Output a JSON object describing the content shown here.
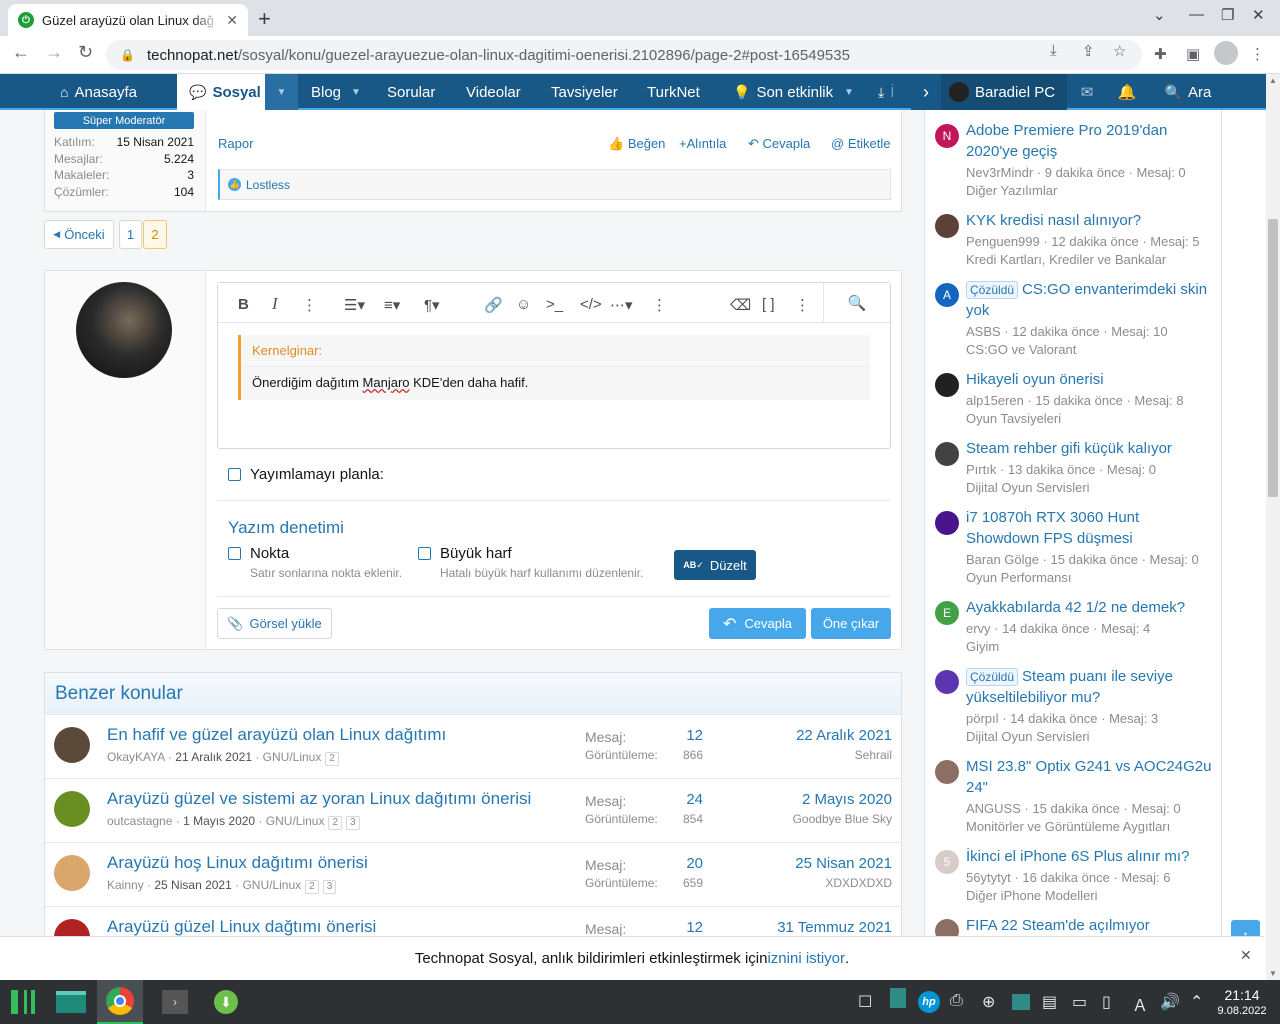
{
  "browser": {
    "tab_title": "Güzel arayüzü olan Linux dağ",
    "url_host": "technopat.net",
    "url_path": "/sosyal/konu/guezel-arayuezue-olan-linux-dagitimi-oenerisi.2102896/page-2#post-16549535",
    "icons": [
      "back-icon",
      "forward-icon",
      "reload-icon",
      "lock-icon",
      "install-icon",
      "share-icon",
      "star-icon",
      "extensions-icon",
      "sidepanel-icon",
      "profile-icon"
    ]
  },
  "nav": {
    "items": [
      "Anasayfa",
      "Sosyal",
      "Blog",
      "Sorular",
      "Videolar",
      "Tavsiyeler",
      "TurkNet",
      "Son etkinlik"
    ],
    "overflow": "İ",
    "account": "Baradiel PC",
    "search": "Ara",
    "colors": {
      "bar": "#185886",
      "accent": "#47a7eb"
    }
  },
  "post": {
    "role_badge": "Süper Moderatör",
    "stats": [
      {
        "k": "Katılım:",
        "v": "15 Nisan 2021"
      },
      {
        "k": "Mesajlar:",
        "v": "5.224"
      },
      {
        "k": "Makaleler:",
        "v": "3"
      },
      {
        "k": "Çözümler:",
        "v": "104"
      }
    ],
    "report": "Rapor",
    "actions": [
      "Beğen",
      "Alıntıla",
      "Cevapla",
      "Etiketle"
    ],
    "reaction_user": "Lostless"
  },
  "pagination": {
    "prev": "Önceki",
    "pages": [
      "1",
      "2"
    ],
    "current": "2"
  },
  "editor": {
    "quote_author": "Kernelginar:",
    "quote_text_a": "Önerdiğim dağıtım ",
    "quote_text_b": "Manjaro",
    "quote_text_c": " KDE'den daha hafif.",
    "schedule_label": "Yayımlamayı planla:",
    "spell_title": "Yazım denetimi",
    "option1_label": "Nokta",
    "option1_hint": "Satır sonlarına nokta eklenir.",
    "option2_label": "Büyük harf",
    "option2_hint": "Hatalı büyük harf kullanımı düzenlenir.",
    "fix_button": "Düzelt",
    "upload_button": "Görsel yükle",
    "reply_button": "Cevapla",
    "preview_button": "Öne çıkar"
  },
  "similar": {
    "title": "Benzer konular",
    "label_msgs": "Mesaj:",
    "label_views": "Görüntüleme:",
    "rows": [
      {
        "title": "En hafif ve güzel arayüzü olan Linux dağıtımı",
        "author": "OkayKAYA",
        "date": "21 Aralık 2021",
        "forum": "GNU/Linux",
        "pages": [
          "2"
        ],
        "msgs": "12",
        "views": "866",
        "last_date": "22 Aralık 2021",
        "last_user": "Sehrail",
        "avatar": "#5a4a3a"
      },
      {
        "title": "Arayüzü güzel ve sistemi az yoran Linux dağıtımı önerisi",
        "author": "outcastagne",
        "date": "1 Mayıs 2020",
        "forum": "GNU/Linux",
        "pages": [
          "2",
          "3"
        ],
        "msgs": "24",
        "views": "854",
        "last_date": "2 Mayıs 2020",
        "last_user": "Goodbye Blue Sky",
        "avatar": "#6b8e23"
      },
      {
        "title": "Arayüzü hoş Linux dağıtımı önerisi",
        "author": "Kainny",
        "date": "25 Nisan 2021",
        "forum": "GNU/Linux",
        "pages": [
          "2",
          "3"
        ],
        "msgs": "20",
        "views": "659",
        "last_date": "25 Nisan 2021",
        "last_user": "XDXDXDXD",
        "avatar": "#d9a66b"
      },
      {
        "title": "Arayüzü güzel Linux dağtımı önerisi",
        "author": "",
        "date": "",
        "forum": "",
        "pages": [],
        "msgs": "12",
        "views": "",
        "last_date": "31 Temmuz 2021",
        "last_user": "",
        "avatar": "#b22222"
      }
    ]
  },
  "sidebar": {
    "solved_badge": "Çözüldü",
    "items": [
      {
        "title": "Adobe Premiere Pro 2019'dan 2020'ye geçiş",
        "solved": false,
        "meta": "Nev3rMindr · 9 dakika önce · Mesaj: 0",
        "forum": "Diğer Yazılımlar",
        "avatar": "#c2185b",
        "letter": "N",
        "lines": 2
      },
      {
        "title": "KYK kredisi nasıl alınıyor?",
        "solved": false,
        "meta": "Penguen999 · 12 dakika önce · Mesaj: 5",
        "forum": "Kredi Kartları, Krediler ve Bankalar",
        "avatar": "#5d4037",
        "letter": "",
        "lines": 1
      },
      {
        "title": "CS:GO envanterimdeki skin yok",
        "solved": true,
        "meta": "ASBS · 12 dakika önce · Mesaj: 10",
        "forum": "CS:GO ve Valorant",
        "avatar": "#1565c0",
        "letter": "A",
        "lines": 2
      },
      {
        "title": "Hikayeli oyun önerisi",
        "solved": false,
        "meta": "alp15eren · 15 dakika önce · Mesaj: 8",
        "forum": "Oyun Tavsiyeleri",
        "avatar": "#212121",
        "letter": "",
        "lines": 1
      },
      {
        "title": "Steam rehber gifi küçük kalıyor",
        "solved": false,
        "meta": "Pırtık · 13 dakika önce · Mesaj: 0",
        "forum": "Dijital Oyun Servisleri",
        "avatar": "#424242",
        "letter": "",
        "lines": 1
      },
      {
        "title": "i7 10870h RTX 3060 Hunt Showdown FPS düşmesi",
        "solved": false,
        "meta": "Baran Gölge · 15 dakika önce · Mesaj: 0",
        "forum": "Oyun Performansı",
        "avatar": "#4a148c",
        "letter": "",
        "lines": 2
      },
      {
        "title": "Ayakkabılarda 42 1/2 ne demek?",
        "solved": false,
        "meta": "ervy · 14 dakika önce · Mesaj: 4",
        "forum": "Giyim",
        "avatar": "#43a047",
        "letter": "E",
        "lines": 1
      },
      {
        "title": "Steam puanı ile seviye yükseltilebiliyor mu?",
        "solved": true,
        "meta": "pörpıl · 14 dakika önce · Mesaj: 3",
        "forum": "Dijital Oyun Servisleri",
        "avatar": "#5e35b1",
        "letter": "",
        "lines": 2
      },
      {
        "title": "MSI 23.8\" Optix G241 vs AOC24G2u 24\"",
        "solved": false,
        "meta": "ANGUSS · 15 dakika önce · Mesaj: 0",
        "forum": "Monitörler ve Görüntüleme Aygıtları",
        "avatar": "#8d6e63",
        "letter": "",
        "lines": 2
      },
      {
        "title": "İkinci el iPhone 6S Plus alınır mı?",
        "solved": false,
        "meta": "56ytytyt · 16 dakika önce · Mesaj: 6",
        "forum": "Diğer iPhone Modelleri",
        "avatar": "#d7ccc8",
        "letter": "5",
        "lines": 1
      },
      {
        "title": "FIFA 22 Steam'de açılmıyor",
        "solved": false,
        "meta": "",
        "forum": "",
        "avatar": "#8d6e63",
        "letter": "",
        "lines": 1
      }
    ]
  },
  "notice": {
    "text": "Technopat Sosyal, anlık bildirimleri etkinleştirmek için ",
    "link": "iznini istiyor",
    "end": "."
  },
  "taskbar": {
    "time": "21:14",
    "date": "9.08.2022"
  }
}
